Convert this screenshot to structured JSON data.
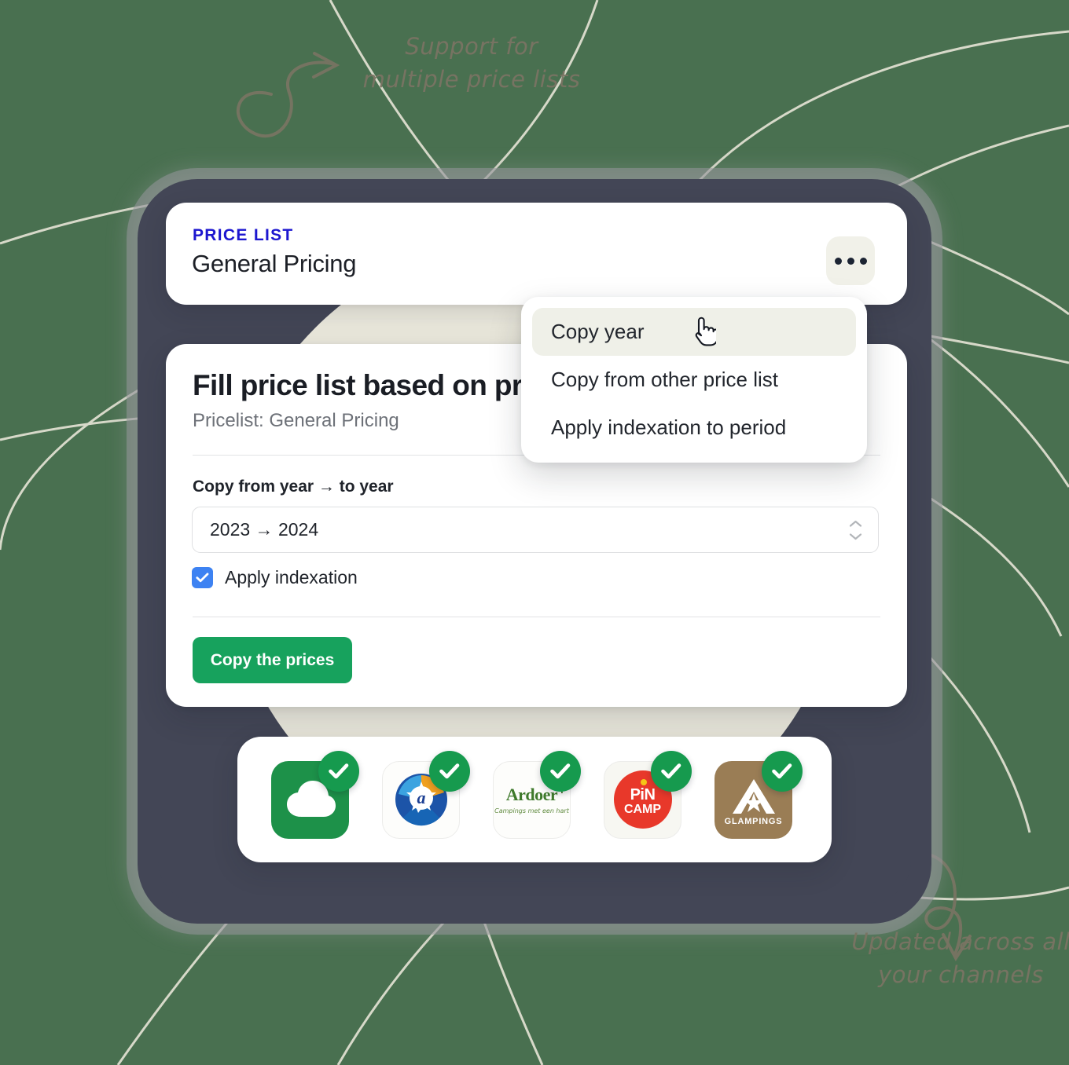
{
  "background": {
    "color": "#497050",
    "frame_color": "#434656",
    "circle_color": "#e9e7db"
  },
  "header": {
    "eyebrow": "PRICE LIST",
    "title": "General Pricing",
    "eyebrow_color": "#1c16cf",
    "overflow_button_name": "..."
  },
  "dialog": {
    "heading": "Fill price list based on previous year",
    "subheading": "Pricelist: General Pricing",
    "field_label": "Copy from year → to year",
    "year_range_value": "2023 → 2024",
    "checkbox_label": "Apply indexation",
    "checkbox_checked": true,
    "checkbox_color": "#3d82f2",
    "submit_label": "Copy the prices",
    "submit_color": "#17a25d"
  },
  "context_menu": {
    "items": [
      {
        "label": "Copy year",
        "active": true
      },
      {
        "label": "Copy from other price list",
        "active": false
      },
      {
        "label": "Apply indexation to period",
        "active": false
      }
    ],
    "cursor_icon": "pointing-hand-cursor"
  },
  "channels": [
    {
      "name": "camping-cloud",
      "label": "",
      "style": "green",
      "checked": true
    },
    {
      "name": "acsi",
      "label": "a",
      "style": "plain",
      "checked": true
    },
    {
      "name": "ardoer",
      "label": "Ardoer",
      "sublabel": "Campings met een hart",
      "style": "plain",
      "checked": true
    },
    {
      "name": "pincamp",
      "label": "PiN",
      "sublabel": "CAMP",
      "style": "plain",
      "checked": true
    },
    {
      "name": "glampings",
      "label": "GLAMPINGS",
      "style": "brown",
      "checked": true
    }
  ],
  "annotations": {
    "top": "Support for\nmultiple price lists",
    "bottom": "Updated across all\nyour channels",
    "color": "#7a7463"
  }
}
